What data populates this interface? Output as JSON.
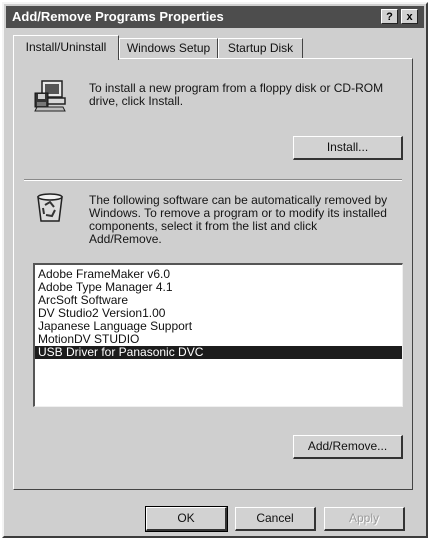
{
  "window": {
    "title": "Add/Remove Programs Properties",
    "help_button": "?",
    "close_button": "x"
  },
  "tabs": [
    {
      "label": "Install/Uninstall",
      "active": true
    },
    {
      "label": "Windows Setup",
      "active": false
    },
    {
      "label": "Startup Disk",
      "active": false
    }
  ],
  "install_section": {
    "icon": "floppy-computer-icon",
    "text_line1": "To install a new program from a floppy disk or CD-ROM",
    "text_line2": "drive, click Install.",
    "button_label": "Install..."
  },
  "uninstall_section": {
    "icon": "recycle-bin-icon",
    "text_line1": "The following software can be automatically removed by",
    "text_line2": "Windows. To remove a program or to modify its installed",
    "text_line3": "components, select it from the list and click",
    "text_line4": "Add/Remove.",
    "programs": [
      "Adobe FrameMaker v6.0",
      "Adobe Type Manager 4.1",
      "ArcSoft Software",
      "DV Studio2 Version1.00",
      "Japanese Language Support",
      "MotionDV STUDIO",
      "USB Driver for Panasonic DVC"
    ],
    "selected_index": 6,
    "add_remove_label": "Add/Remove..."
  },
  "footer": {
    "ok_label": "OK",
    "cancel_label": "Cancel",
    "apply_label": "Apply"
  },
  "colors": {
    "titlebar": "#4d4d4d",
    "dialog": "#cfcfcf",
    "selection": "#1c1c1c"
  }
}
